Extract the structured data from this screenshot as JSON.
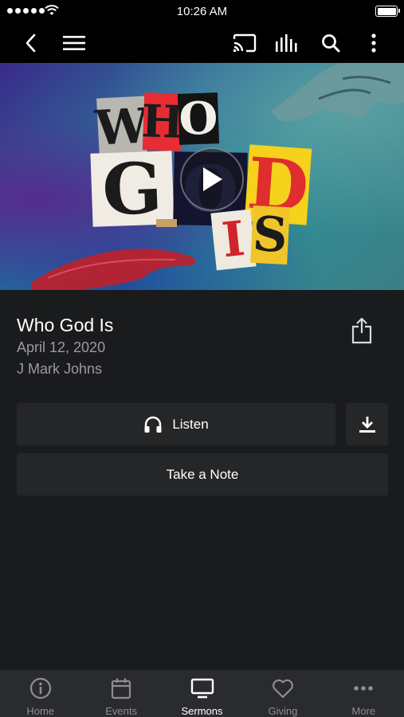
{
  "status_bar": {
    "time": "10:26 AM"
  },
  "nav": {
    "back_icon": "chevron-left-icon",
    "menu_icon": "hamburger-menu-icon",
    "cast_icon": "cast-icon",
    "audio_icon": "audio-bars-icon",
    "search_icon": "search-icon",
    "more_icon": "vertical-ellipsis-icon"
  },
  "hero": {
    "artwork_letters": [
      "W",
      "H",
      "O",
      "G",
      "O",
      "D",
      "I",
      "S"
    ],
    "play_icon": "play-icon"
  },
  "sermon": {
    "title": "Who God Is",
    "date": "April 12, 2020",
    "speaker": "J Mark Johns",
    "share_icon": "share-icon"
  },
  "actions": {
    "listen_label": "Listen",
    "listen_icon": "headphones-icon",
    "download_icon": "download-icon",
    "note_label": "Take a Note"
  },
  "tabs": [
    {
      "label": "Home",
      "icon": "info-circle-icon",
      "active": false
    },
    {
      "label": "Events",
      "icon": "calendar-icon",
      "active": false
    },
    {
      "label": "Sermons",
      "icon": "tv-icon",
      "active": true
    },
    {
      "label": "Giving",
      "icon": "heart-icon",
      "active": false
    },
    {
      "label": "More",
      "icon": "more-dots-icon",
      "active": false
    }
  ],
  "colors": {
    "background": "#1a1b1d",
    "button": "#252628",
    "tab_bar": "#2a2b2e",
    "muted_text": "#9a9b9e"
  }
}
